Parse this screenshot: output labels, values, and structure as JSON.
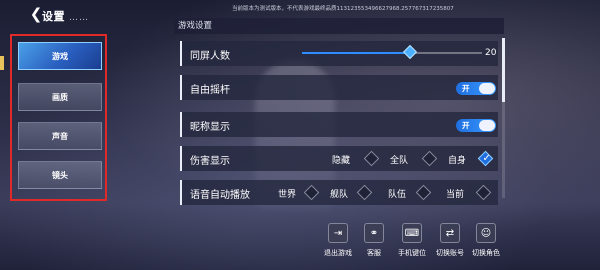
{
  "header": {
    "title": "设置",
    "title_dots": "……",
    "version_text": "当前版本为测试版本，不代表游戏最终品质1131235534966279​68.257767317235807"
  },
  "sidebar": {
    "tabs": [
      {
        "label": "游戏",
        "active": true
      },
      {
        "label": "画质",
        "active": false
      },
      {
        "label": "声音",
        "active": false
      },
      {
        "label": "镜头",
        "active": false
      }
    ]
  },
  "panel": {
    "section_title": "游戏设置",
    "rows": {
      "screen_players": {
        "label": "同屏人数",
        "value": "20",
        "level": 0.6
      },
      "free_joystick": {
        "label": "自由摇杆",
        "toggle": "开"
      },
      "nickname_display": {
        "label": "昵称显示",
        "toggle": "开"
      },
      "damage_display": {
        "label": "伤害显示",
        "options": [
          "隐藏",
          "全队",
          "自身"
        ],
        "selected": "自身"
      },
      "voice_autoplay": {
        "label": "语音自动播放",
        "options": [
          "世界",
          "舰队",
          "队伍",
          "当前"
        ]
      }
    }
  },
  "bottom_buttons": [
    {
      "label": "退出游戏",
      "icon": "exit-icon"
    },
    {
      "label": "客服",
      "icon": "headset-icon"
    },
    {
      "label": "手机键位",
      "icon": "keyboard-icon"
    },
    {
      "label": "切换账号",
      "icon": "account-switch-icon"
    },
    {
      "label": "切换角色",
      "icon": "character-switch-icon"
    }
  ],
  "colors": {
    "accent": "#2d8cff",
    "highlight_border": "#e02a2a"
  }
}
